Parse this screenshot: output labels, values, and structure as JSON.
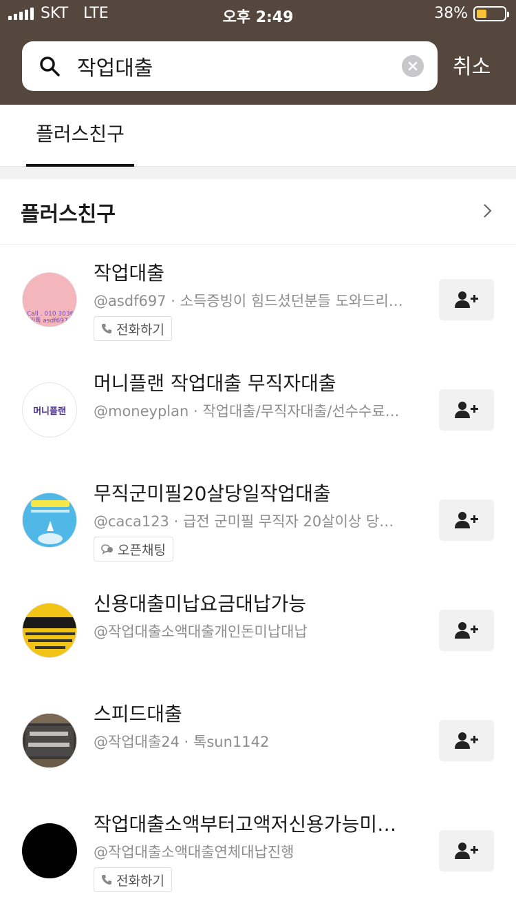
{
  "status": {
    "carrier": "SKT",
    "network": "LTE",
    "time": "오후 2:49",
    "battery": "38%",
    "battery_level": 0.38
  },
  "search": {
    "query": "작업대출",
    "cancel_label": "취소"
  },
  "tabs": [
    {
      "label": "플러스친구",
      "active": true
    }
  ],
  "section": {
    "title": "플러스친구"
  },
  "results": [
    {
      "name": "작업대출",
      "subtitle": "@asdf697 · 소득증빙이 힘드셨던분들 도와드리…",
      "tag": "전화하기",
      "tag_icon": "phone-icon"
    },
    {
      "name": "머니플랜 작업대출 무직자대출",
      "subtitle": "@moneyplan · 작업대출/무직자대출/선수수료…",
      "avatar_text": "머니플랜"
    },
    {
      "name": "무직군미필20살당일작업대출",
      "subtitle": "@caca123 · 급전 군미필 무직자 20살이상 당…",
      "tag": "오픈채팅",
      "tag_icon": "chat-bubble-icon"
    },
    {
      "name": "신용대출미납요금대납가능",
      "subtitle": "@작업대출소액대출개인돈미납대납"
    },
    {
      "name": "스피드대출",
      "subtitle": "@작업대출24 · 톡sun1142"
    },
    {
      "name": "작업대출소액부터고액저신용가능미…",
      "subtitle": "@작업대출소액대출연체대납진행",
      "tag": "전화하기",
      "tag_icon": "phone-icon"
    }
  ],
  "colors": {
    "header_bg": "#56473e",
    "battery_fill": "#f7c233"
  }
}
